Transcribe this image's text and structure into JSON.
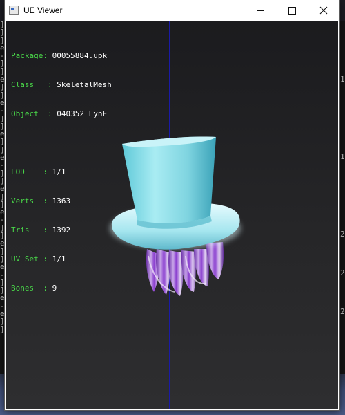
{
  "window": {
    "title": "UE Viewer",
    "controls": [
      "minimize",
      "maximize",
      "close"
    ]
  },
  "info_panel": {
    "package": {
      "label": "Package",
      "value": "00055884.upk"
    },
    "class": {
      "label": "Class",
      "value": "SkeletalMesh"
    },
    "object": {
      "label": "Object",
      "value": "040352_LynF"
    },
    "lod": {
      "label": "LOD",
      "value": "1/1"
    },
    "verts": {
      "label": "Verts",
      "value": "1363"
    },
    "tris": {
      "label": "Tris",
      "value": "1392"
    },
    "uv_set": {
      "label": "UV Set",
      "value": "1/1"
    },
    "bones": {
      "label": "Bones",
      "value": "9"
    }
  },
  "viewport": {
    "model": "top-hat-with-purple-hair",
    "colors": {
      "background": "#1c1c1f",
      "axis": "#1a1aa8",
      "label_key": "#49d649",
      "label_value": "#ffffff",
      "hat": "#8fe3ec",
      "hair": "#8a3ecf"
    }
  },
  "background_window": {
    "left_glyphs": [
      "]",
      "]",
      "]",
      "e",
      "-",
      "]",
      "]",
      "e",
      "]",
      "]",
      "e",
      "-",
      "]",
      "]",
      "e",
      "]",
      "]",
      "e",
      "-",
      "]",
      "]",
      "e",
      "]",
      "]",
      "e",
      "-",
      "]",
      "]",
      "e",
      "]",
      "]",
      "e",
      "-",
      "]",
      "]",
      "e",
      "-",
      "e",
      "]",
      "]"
    ],
    "right_glyphs": [
      "1",
      "1",
      "2",
      "2",
      "2"
    ]
  }
}
